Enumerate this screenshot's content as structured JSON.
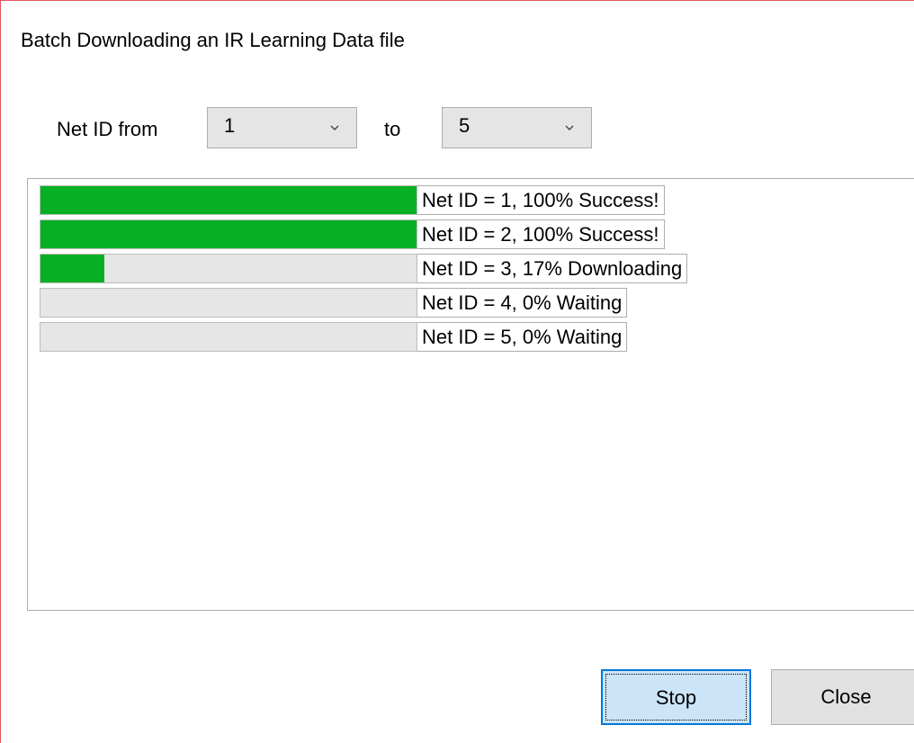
{
  "window": {
    "title": "Batch Downloading an IR Learning Data file"
  },
  "range": {
    "from_label": "Net ID from",
    "from_value": "1",
    "to_label": "to",
    "to_value": "5"
  },
  "downloads": [
    {
      "progress": 1.0,
      "status": "Net ID = 1, 100% Success!"
    },
    {
      "progress": 1.0,
      "status": "Net ID = 2, 100% Success!"
    },
    {
      "progress": 0.17,
      "status": "Net ID = 3, 17% Downloading"
    },
    {
      "progress": 0.0,
      "status": "Net ID = 4, 0% Waiting"
    },
    {
      "progress": 0.0,
      "status": "Net ID = 5, 0% Waiting"
    }
  ],
  "buttons": {
    "stop_label": "Stop",
    "close_label": "Close"
  },
  "colors": {
    "progress_fill": "#06b025",
    "window_border": "#e1575c",
    "focus_button_border": "#0078d7",
    "focus_button_bg": "#cce4f7"
  },
  "icons": {
    "combo_dropdown": "chevron-down-icon"
  }
}
